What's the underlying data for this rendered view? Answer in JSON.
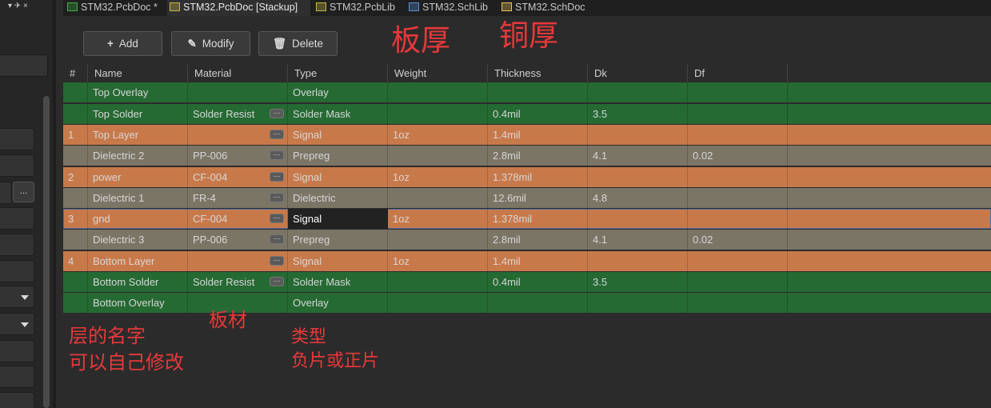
{
  "left_panel": {
    "controls": "▾ ✈ ×",
    "ellipsis": "..."
  },
  "tabs": [
    {
      "label": "STM32.PcbDoc *",
      "color": "#3fae49",
      "active": false
    },
    {
      "label": "STM32.PcbDoc [Stackup]",
      "color": "#c7b84b",
      "active": true
    },
    {
      "label": "STM32.PcbLib",
      "color": "#c7b84b",
      "active": false
    },
    {
      "label": "STM32.SchLib",
      "color": "#5a8fd6",
      "active": false
    },
    {
      "label": "STM32.SchDoc",
      "color": "#e6c15a",
      "active": false
    }
  ],
  "toolbar": {
    "add_label": "Add",
    "modify_label": "Modify",
    "delete_label": "Delete"
  },
  "columns": [
    "#",
    "Name",
    "Material",
    "Type",
    "Weight",
    "Thickness",
    "Dk",
    "Df"
  ],
  "colors": {
    "green": "#256933",
    "orange": "#c8794a",
    "gray": "#7b7566",
    "selected_type_bg": "#222222",
    "annotation": "#e8383b"
  },
  "layers": [
    {
      "num": "",
      "name": "Top Overlay",
      "material": "",
      "type": "Overlay",
      "weight": "",
      "thickness": "",
      "dk": "",
      "df": "",
      "kind": "green",
      "ellipsis": false
    },
    {
      "num": "",
      "name": "Top Solder",
      "material": "Solder Resist",
      "type": "Solder Mask",
      "weight": "",
      "thickness": "0.4mil",
      "dk": "3.5",
      "df": "",
      "kind": "green",
      "ellipsis": true
    },
    {
      "num": "1",
      "name": "Top Layer",
      "material": "",
      "type": "Signal",
      "weight": "1oz",
      "thickness": "1.4mil",
      "dk": "",
      "df": "",
      "kind": "orange",
      "ellipsis": true
    },
    {
      "num": "",
      "name": "Dielectric 2",
      "material": "PP-006",
      "type": "Prepreg",
      "weight": "",
      "thickness": "2.8mil",
      "dk": "4.1",
      "df": "0.02",
      "kind": "gray",
      "ellipsis": true
    },
    {
      "num": "2",
      "name": "power",
      "material": "CF-004",
      "type": "Signal",
      "weight": "1oz",
      "thickness": "1.378mil",
      "dk": "",
      "df": "",
      "kind": "orange",
      "ellipsis": true
    },
    {
      "num": "",
      "name": "Dielectric 1",
      "material": "FR-4",
      "type": "Dielectric",
      "weight": "",
      "thickness": "12.6mil",
      "dk": "4.8",
      "df": "",
      "kind": "gray",
      "ellipsis": true
    },
    {
      "num": "3",
      "name": "gnd",
      "material": "CF-004",
      "type": "Signal",
      "weight": "1oz",
      "thickness": "1.378mil",
      "dk": "",
      "df": "",
      "kind": "orange",
      "ellipsis": true,
      "selected": true
    },
    {
      "num": "",
      "name": "Dielectric 3",
      "material": "PP-006",
      "type": "Prepreg",
      "weight": "",
      "thickness": "2.8mil",
      "dk": "4.1",
      "df": "0.02",
      "kind": "gray",
      "ellipsis": true
    },
    {
      "num": "4",
      "name": "Bottom Layer",
      "material": "",
      "type": "Signal",
      "weight": "1oz",
      "thickness": "1.4mil",
      "dk": "",
      "df": "",
      "kind": "orange",
      "ellipsis": true
    },
    {
      "num": "",
      "name": "Bottom Solder",
      "material": "Solder Resist",
      "type": "Solder Mask",
      "weight": "",
      "thickness": "0.4mil",
      "dk": "3.5",
      "df": "",
      "kind": "green",
      "ellipsis": true
    },
    {
      "num": "",
      "name": "Bottom Overlay",
      "material": "",
      "type": "Overlay",
      "weight": "",
      "thickness": "",
      "dk": "",
      "df": "",
      "kind": "green",
      "ellipsis": false
    }
  ],
  "annotations": {
    "board_thickness": "板厚",
    "copper_thickness": "铜厚",
    "layer_name_line1": "层的名字",
    "layer_name_line2": "可以自己修改",
    "material": "板材",
    "type_line1": "类型",
    "type_line2": "负片或正片"
  }
}
